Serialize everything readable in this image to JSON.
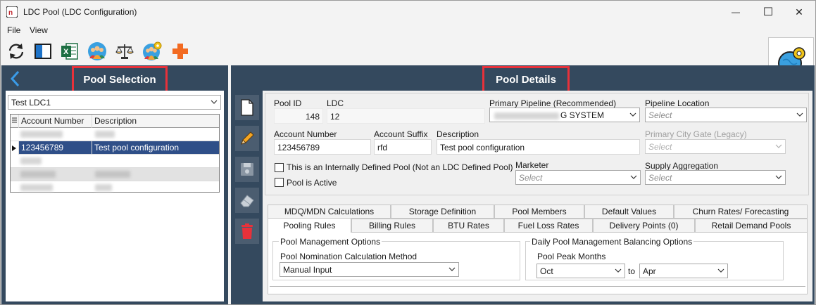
{
  "window": {
    "title": "LDC Pool (LDC Configuration)",
    "minimize_glyph": "—",
    "maximize_glyph": "☐",
    "close_glyph": "✕"
  },
  "menu": {
    "file": "File",
    "view": "View"
  },
  "toolbar": {
    "icons": [
      "refresh-icon",
      "panel-toggle-icon",
      "excel-icon",
      "users-icon",
      "balance-scale-icon",
      "users-settings-icon",
      "add-cross-icon"
    ],
    "settings_icon": "globe-gear-icon"
  },
  "left": {
    "title": "Pool Selection",
    "ldc_select": "Test LDC1",
    "grid": {
      "headers": [
        "Account Number",
        "Description"
      ],
      "selected_row": {
        "account": "123456789",
        "description": "Test pool configuration"
      }
    }
  },
  "right": {
    "title": "Pool Details",
    "fields": {
      "pool_id_label": "Pool ID",
      "pool_id": "148",
      "ldc_label": "LDC",
      "ldc": "12",
      "primary_pipeline_label": "Primary Pipeline (Recommended)",
      "primary_pipeline": "G SYSTEM",
      "pipeline_location_label": "Pipeline Location",
      "pipeline_location": "Select",
      "account_number_label": "Account Number",
      "account_number": "123456789",
      "account_suffix_label": "Account Suffix",
      "account_suffix": "rfd",
      "description_label": "Description",
      "description": "Test pool configuration",
      "primary_city_gate_label": "Primary City Gate (Legacy)",
      "primary_city_gate": "Select",
      "internal_pool_label": "This is an Internally Defined Pool (Not an LDC Defined Pool)",
      "pool_active_label": "Pool is Active",
      "marketer_label": "Marketer",
      "marketer": "Select",
      "supply_aggregation_label": "Supply Aggregation",
      "supply_aggregation": "Select"
    },
    "tabs_row1": [
      "MDQ/MDN Calculations",
      "Storage Definition",
      "Pool Members",
      "Default Values",
      "Churn Rates/ Forecasting"
    ],
    "tabs_row2": [
      "Pooling Rules",
      "Billing Rules",
      "BTU Rates",
      "Fuel Loss Rates",
      "Delivery Points (0)",
      "Retail Demand Pools"
    ],
    "pool_mgmt": {
      "title": "Pool Management Options",
      "method_label": "Pool Nomination Calculation Method",
      "method": "Manual Input"
    },
    "daily_balancing": {
      "title": "Daily Pool Management Balancing Options",
      "peak_label": "Pool Peak Months",
      "from": "Oct",
      "to_label": "to",
      "to": "Apr"
    }
  },
  "colors": {
    "panel_bg": "#34495e",
    "highlight_border": "#e8313a",
    "selected_row": "#2f4f88"
  }
}
